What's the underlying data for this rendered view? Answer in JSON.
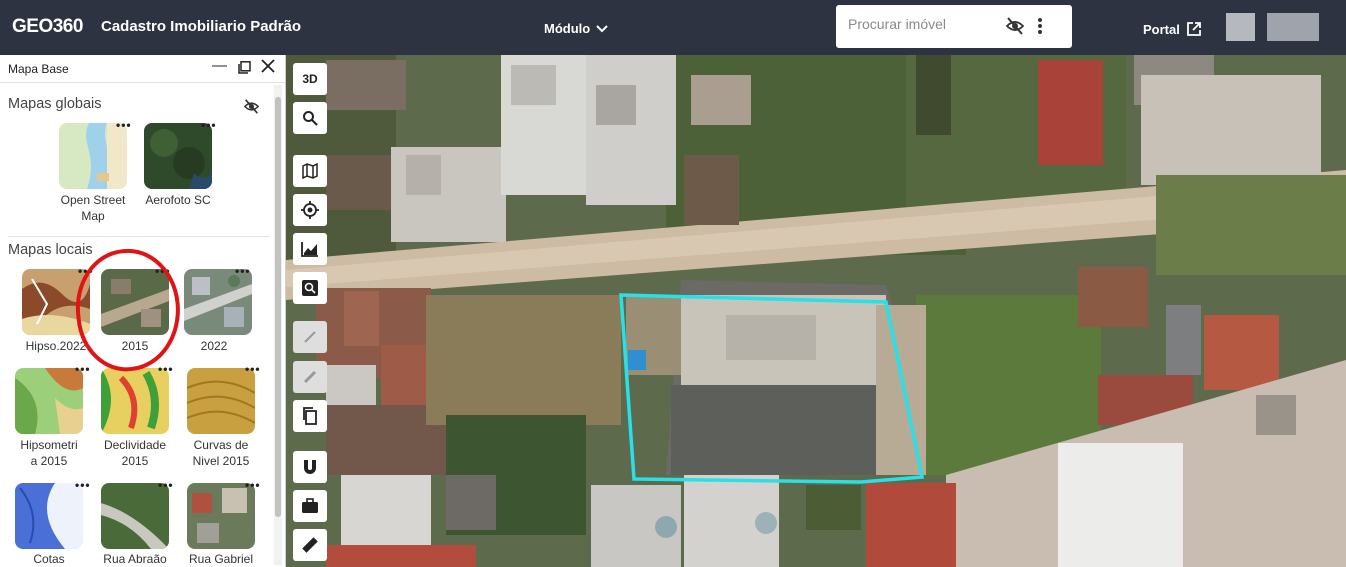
{
  "header": {
    "logo": "GEO360",
    "app_title": "Cadastro Imobiliario Padrão",
    "modulo_label": "Módulo",
    "search_placeholder": "Procurar imóvel",
    "portal_label": "Portal"
  },
  "panel": {
    "title": "Mapa Base",
    "global_section": "Mapas globais",
    "local_section": "Mapas locais",
    "global_maps": [
      {
        "label_line1": "Open Street",
        "label_line2": "Map"
      },
      {
        "label_line1": "Aerofoto SC",
        "label_line2": ""
      }
    ],
    "local_maps": [
      {
        "label_line1": "Hipso.2022",
        "label_line2": ""
      },
      {
        "label_line1": "2015",
        "label_line2": ""
      },
      {
        "label_line1": "2022",
        "label_line2": ""
      },
      {
        "label_line1": "Hipsometri",
        "label_line2": "a 2015"
      },
      {
        "label_line1": "Declividade",
        "label_line2": "2015"
      },
      {
        "label_line1": "Curvas de",
        "label_line2": "Nivel 2015"
      },
      {
        "label_line1": "Cotas",
        "label_line2": ""
      },
      {
        "label_line1": "Rua Abraão",
        "label_line2": ""
      },
      {
        "label_line1": "Rua Gabriel",
        "label_line2": ""
      }
    ],
    "tile_menu": "•••"
  },
  "toolbar": {
    "btn_3d": "3D"
  },
  "colors": {
    "topbar": "#2d3340",
    "accent_parcel": "#27e0e8",
    "highlight_circle": "#e01414"
  }
}
